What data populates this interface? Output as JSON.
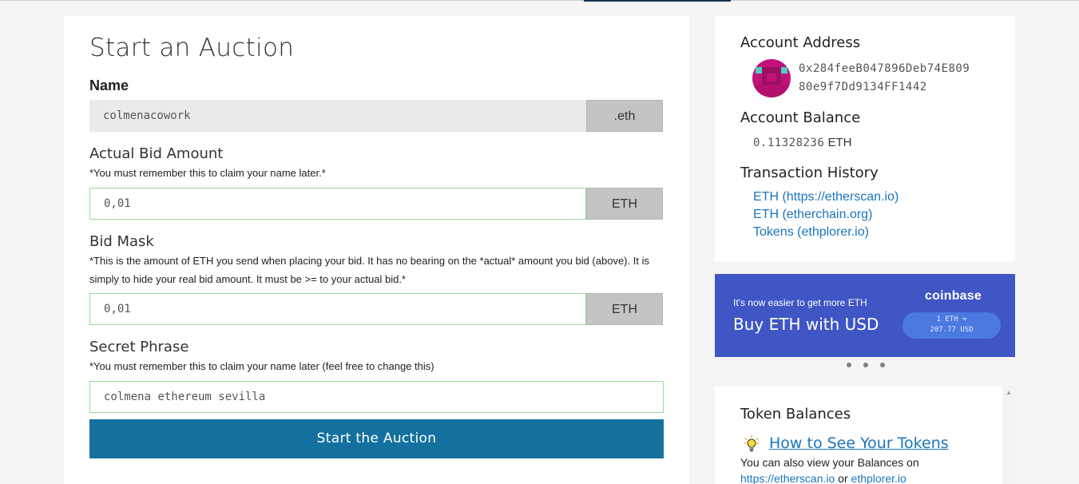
{
  "auction": {
    "title": "Start an Auction",
    "name_label": "Name",
    "name_value": "colmenacowork",
    "name_suffix": ".eth",
    "bid_label": "Actual Bid Amount",
    "bid_note": "*You must remember this to claim your name later.*",
    "bid_value": "0,01",
    "bid_suffix": "ETH",
    "mask_label": "Bid Mask",
    "mask_note": "*This is the amount of ETH you send when placing your bid. It has no bearing on the *actual* amount you bid (above). It is simply to hide your real bid amount. It must be >= to your actual bid.*",
    "mask_value": "0,01",
    "mask_suffix": "ETH",
    "secret_label": "Secret Phrase",
    "secret_note": "*You must remember this to claim your name later (feel free to change this)",
    "secret_value": "colmena ethereum sevilla",
    "submit_label": "Start the Auction"
  },
  "account": {
    "address_label": "Account Address",
    "address_line1": "0x284feeB047896Deb74E809",
    "address_line2": "80e9f7Dd9134FF1442",
    "balance_label": "Account Balance",
    "balance_value": "0.11328236",
    "balance_unit": "ETH",
    "history_label": "Transaction History",
    "history_links": [
      "ETH (https://etherscan.io)",
      "ETH (etherchain.org)",
      "Tokens (ethplorer.io)"
    ]
  },
  "banner": {
    "small_text": "It's now easier to get more ETH",
    "big_text": "Buy ETH with USD",
    "brand": "coinbase",
    "rate_line1": "1 ETH ≈",
    "rate_line2": "207.77 USD"
  },
  "tokens": {
    "title": "Token Balances",
    "howto_link": "How to See Your Tokens",
    "text_prefix": "You can also view your Balances on",
    "link1": "https://etherscan.io",
    "or": " or ",
    "link2": "ethplorer.io"
  },
  "colors": {
    "primary_button": "#14719f",
    "link": "#1b75bb",
    "banner_bg": "#3f56c4",
    "valid_border": "#98dc9a"
  },
  "icons": [
    "lightbulb-icon",
    "identicon-avatar"
  ]
}
